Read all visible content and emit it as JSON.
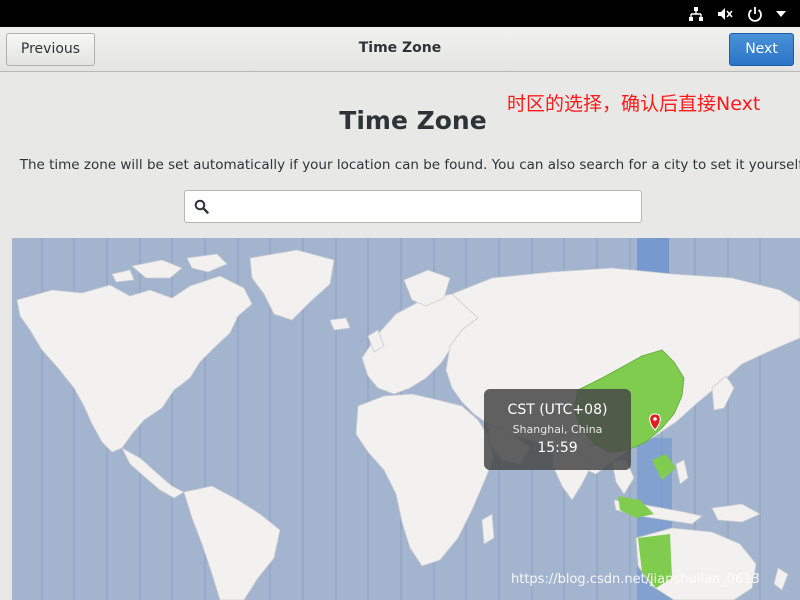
{
  "topbar": {
    "icons": [
      "network-icon",
      "volume-icon",
      "power-icon",
      "chevron-down-icon"
    ]
  },
  "header": {
    "previous_label": "Previous",
    "title": "Time Zone",
    "next_label": "Next"
  },
  "annotation": "时区的选择，确认后直接Next",
  "page": {
    "heading": "Time Zone",
    "description": "The time zone will be set automatically if your location can be found. You can also search for a city to set it yourself."
  },
  "search": {
    "value": "",
    "icon": "search-icon"
  },
  "map": {
    "highlight_color": "#7fcc4f",
    "ocean_color": "#a3b4cf",
    "land_color": "#f2f1ef",
    "pin_color": "#e01b24",
    "tooltip": {
      "abbreviation": "CST (UTC+08)",
      "city": "Shanghai, China",
      "time": "15:59"
    }
  },
  "watermark": "https://blog.csdn.net/jianshuilan_0613",
  "colors": {
    "next_button": "#2a76c6",
    "annotation": "#ff1a1a"
  }
}
